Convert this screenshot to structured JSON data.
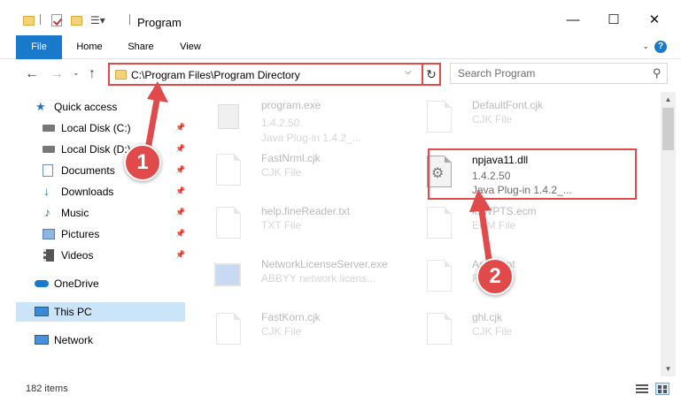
{
  "window": {
    "title": "Program",
    "controls": {
      "minimize": "—",
      "maximize": "☐",
      "close": "✕"
    }
  },
  "ribbon": {
    "tabs": [
      {
        "label": "File"
      },
      {
        "label": "Home"
      },
      {
        "label": "Share"
      },
      {
        "label": "View"
      }
    ]
  },
  "address_bar": {
    "path": "C:\\Program Files\\Program Directory",
    "dropdown_glyph": "⌵",
    "refresh_glyph": "↻"
  },
  "search": {
    "placeholder": "Search Program",
    "icon": "search-icon"
  },
  "sidebar": {
    "items": [
      {
        "label": "Quick access",
        "icon": "star-icon",
        "pinned": false
      },
      {
        "label": "Local Disk (C:)",
        "icon": "drive-icon",
        "pinned": true
      },
      {
        "label": "Local Disk (D:)",
        "icon": "drive-icon",
        "pinned": true
      },
      {
        "label": "Documents",
        "icon": "documents-icon",
        "pinned": true
      },
      {
        "label": "Downloads",
        "icon": "download-icon",
        "pinned": true
      },
      {
        "label": "Music",
        "icon": "music-icon",
        "pinned": true
      },
      {
        "label": "Pictures",
        "icon": "pictures-icon",
        "pinned": true
      },
      {
        "label": "Videos",
        "icon": "videos-icon",
        "pinned": true
      },
      {
        "label": "OneDrive",
        "icon": "cloud-icon",
        "pinned": false
      },
      {
        "label": "This PC",
        "icon": "computer-icon",
        "pinned": false,
        "selected": true
      },
      {
        "label": "Network",
        "icon": "network-icon",
        "pinned": false
      }
    ]
  },
  "files": [
    {
      "name": "program.exe",
      "line2": "1.4.2.50",
      "line3": "Java Plug-in 1.4.2_...",
      "icon": "app-icon",
      "faded": true
    },
    {
      "name": "DefaultFont.cjk",
      "line2": "CJK File",
      "line3": "",
      "icon": "document-icon",
      "faded": true
    },
    {
      "name": "FastNrml.cjk",
      "line2": "CJK File",
      "line3": "",
      "icon": "document-icon",
      "faded": true
    },
    {
      "name": "npjava11.dll",
      "line2": "1.4.2.50",
      "line3": "Java Plug-in 1.4.2_...",
      "icon": "gear-file-icon",
      "faded": false,
      "highlighted": true
    },
    {
      "name": "help.fineReader.txt",
      "line2": "TXT File",
      "line3": "",
      "icon": "document-icon",
      "faded": true
    },
    {
      "name": "ksWPTS.ecm",
      "line2": "ECM File",
      "line3": "",
      "icon": "document-icon",
      "faded": true
    },
    {
      "name": "NetworkLicenseServer.exe",
      "line2": "ABBYY network licens...",
      "line3": "",
      "icon": "app-icon",
      "faded": true
    },
    {
      "name": "Assistant",
      "line2": "File",
      "line3": "",
      "icon": "document-icon",
      "faded": true
    },
    {
      "name": "FastKorn.cjk",
      "line2": "CJK File",
      "line3": "",
      "icon": "document-icon",
      "faded": true
    },
    {
      "name": "ghl.cjk",
      "line2": "CJK File",
      "line3": "",
      "icon": "document-icon",
      "faded": true
    }
  ],
  "status": {
    "item_count": "182 items"
  },
  "callouts": [
    {
      "label": "1"
    },
    {
      "label": "2"
    }
  ],
  "colors": {
    "accent": "#1979ca",
    "highlight": "#e04a4a",
    "selected": "#cce4f7",
    "folder": "#f4d27a"
  }
}
